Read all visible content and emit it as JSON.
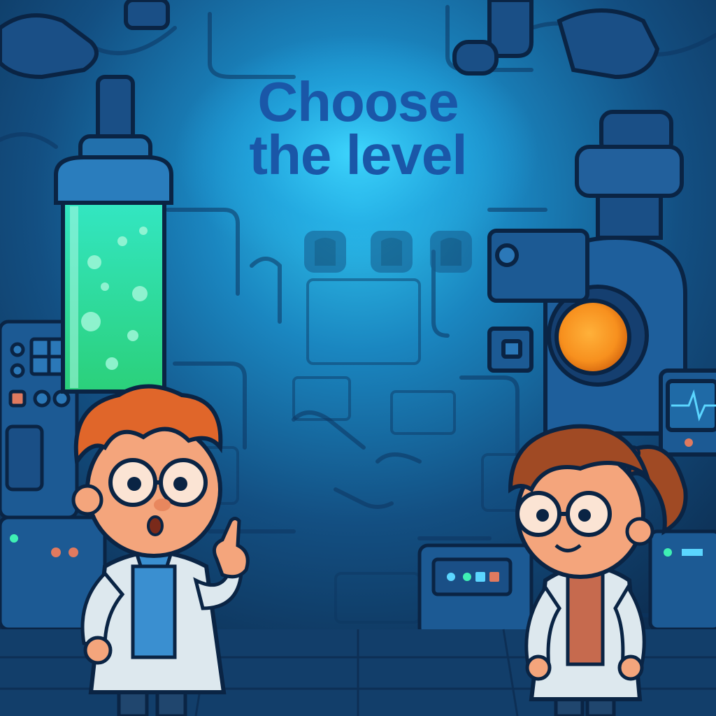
{
  "menu": {
    "title_line1": "Choose",
    "title_line2": "the level"
  },
  "level_slots": 3,
  "colors": {
    "background": "#144a7a",
    "glow": "#2fc6f0",
    "title": "#1a57a8",
    "liquid": "#3ff0b4",
    "orange_light": "#f7901e",
    "hair_boy": "#e0662a",
    "hair_girl": "#a04a24",
    "coat": "#dde8ee"
  }
}
